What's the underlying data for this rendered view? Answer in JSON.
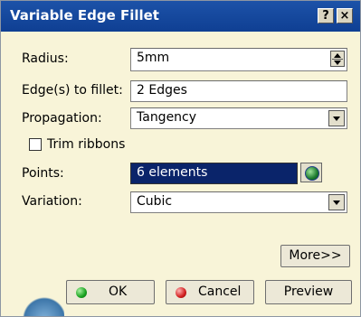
{
  "dialog": {
    "title": "Variable Edge Fillet",
    "help_glyph": "?",
    "close_glyph": "×"
  },
  "radius": {
    "label": "Radius:",
    "value": "5mm"
  },
  "edges": {
    "label": "Edge(s) to fillet:",
    "value": "2 Edges"
  },
  "propagation": {
    "label": "Propagation:",
    "value": "Tangency"
  },
  "trim": {
    "label": "Trim ribbons",
    "checked": false
  },
  "points": {
    "label": "Points:",
    "value": "6 elements"
  },
  "variation": {
    "label": "Variation:",
    "value": "Cubic"
  },
  "buttons": {
    "more": "More>>",
    "ok": "OK",
    "cancel": "Cancel",
    "preview": "Preview"
  },
  "colors": {
    "titlebar": "#1c52a8",
    "selected": "#0a246a",
    "ok_icon": "#18a21f",
    "cancel_icon": "#d11e1e"
  }
}
